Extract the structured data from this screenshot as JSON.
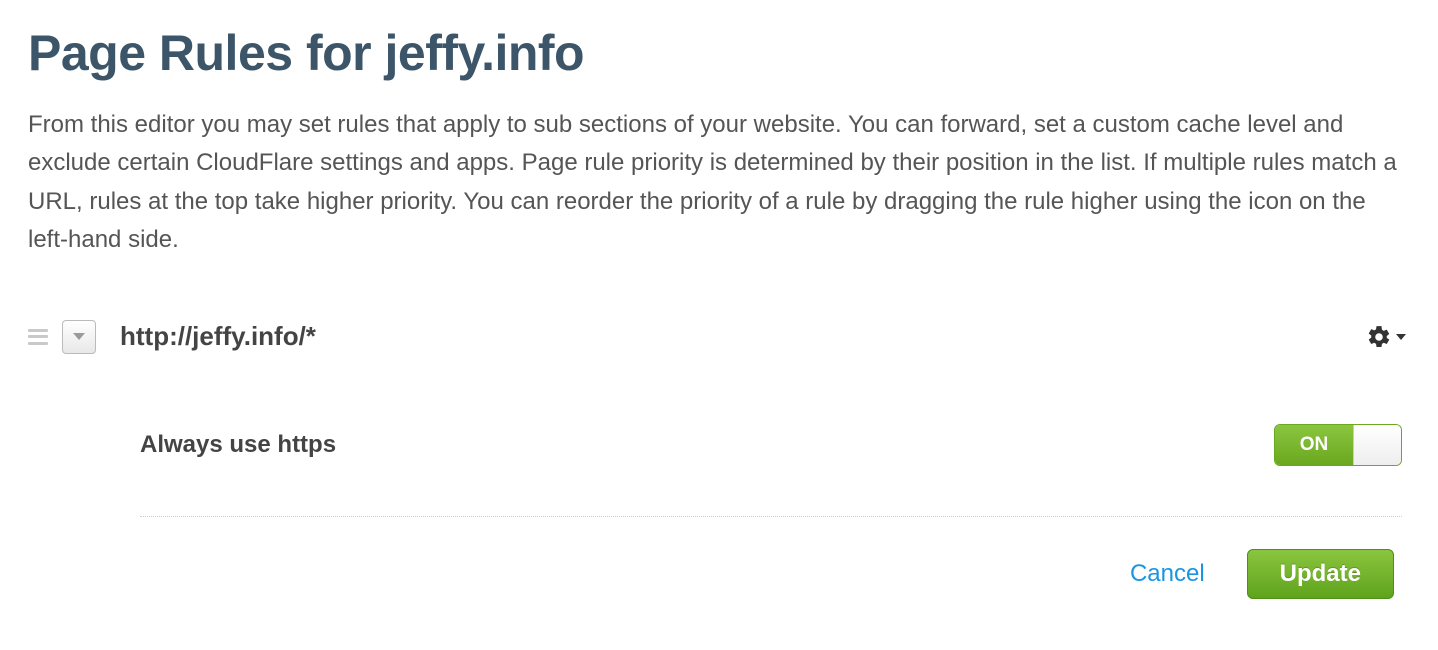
{
  "header": {
    "title": "Page Rules for jeffy.info",
    "description": "From this editor you may set rules that apply to sub sections of your website. You can forward, set a custom cache level and exclude certain CloudFlare settings and apps. Page rule priority is determined by their position in the list. If multiple rules match a URL, rules at the top take higher priority. You can reorder the priority of a rule by dragging the rule higher using the icon on the left-hand side."
  },
  "rule": {
    "url_pattern": "http://jeffy.info/*",
    "settings": {
      "always_https_label": "Always use https",
      "always_https_on": "ON"
    }
  },
  "actions": {
    "cancel": "Cancel",
    "update": "Update"
  }
}
